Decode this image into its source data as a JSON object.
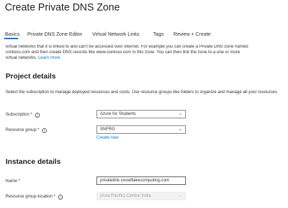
{
  "header": {
    "title": "Create Private DNS Zone",
    "more_label": "···"
  },
  "tabs": [
    {
      "label": "Basics"
    },
    {
      "label": "Private DNS Zone Editor"
    },
    {
      "label": "Virtual Network Links"
    },
    {
      "label": "Tags"
    },
    {
      "label": "Review + Create"
    }
  ],
  "intro": {
    "line1": "virtual networks that it is linked to and can't be accessed over internet. For example you can create a Private DNS zone named",
    "line2": "contoso.com and then create DNS records like www.contoso.com in this zone. You can then link the zone to a one or more",
    "line3": "virtual networks.",
    "learn_more": "Learn more"
  },
  "project_details": {
    "heading": "Project details",
    "description": "Select the subscription to manage deployed resources and costs. Use resource groups like folders to organize and manage all your resources.",
    "subscription_label": "Subscription *",
    "subscription_value": "Azure for Students",
    "resource_group_label": "Resource group *",
    "resource_group_value": "SNFRG",
    "create_new_label": "Create new"
  },
  "instance_details": {
    "heading": "Instance details",
    "name_label": "Name *",
    "name_value": "privatelink.snowflakecomputing.com",
    "location_label": "Resource group location *",
    "location_value": "(Asia Pacific) Central India"
  },
  "icons": {
    "info": "info-icon",
    "chevron": "chevron-down-icon"
  },
  "colors": {
    "accent": "#0078d4",
    "text": "#323130"
  }
}
